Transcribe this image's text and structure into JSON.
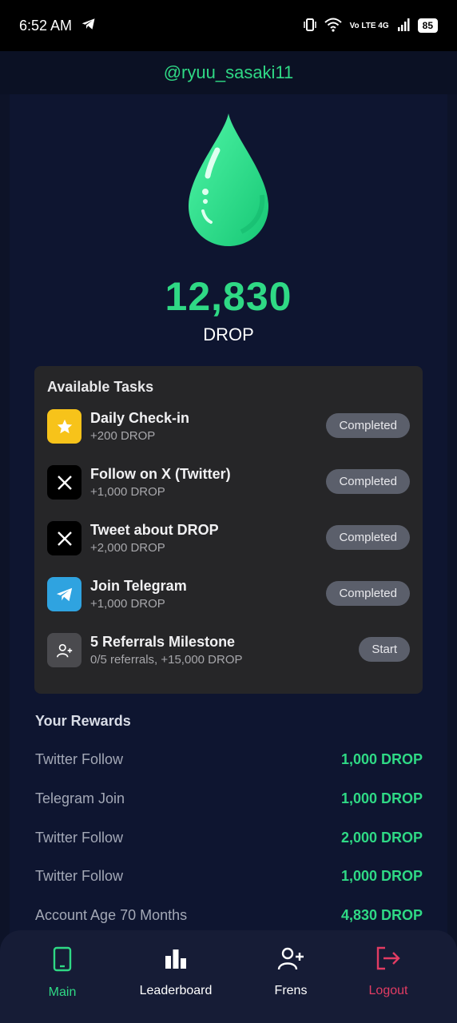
{
  "status_bar": {
    "time": "6:52 AM",
    "network": "Vo LTE 4G",
    "battery": "85"
  },
  "header": {
    "username": "@ryuu_sasaki11"
  },
  "balance": {
    "amount": "12,830",
    "unit": "DROP"
  },
  "tasks": {
    "title": "Available Tasks",
    "items": [
      {
        "name": "Daily Check-in",
        "reward": "+200 DROP",
        "action": "Completed",
        "icon": "star-icon",
        "color": "#f7c31a"
      },
      {
        "name": "Follow on X (Twitter)",
        "reward": "+1,000 DROP",
        "action": "Completed",
        "icon": "x-logo-icon",
        "color": "#000000"
      },
      {
        "name": "Tweet about DROP",
        "reward": "+2,000 DROP",
        "action": "Completed",
        "icon": "x-logo-icon",
        "color": "#000000"
      },
      {
        "name": "Join Telegram",
        "reward": "+1,000 DROP",
        "action": "Completed",
        "icon": "telegram-icon",
        "color": "#2fa3e0"
      },
      {
        "name": "5 Referrals Milestone",
        "reward": "0/5 referrals, +15,000 DROP",
        "action": "Start",
        "icon": "add-user-icon",
        "color": "#4a4a4e"
      }
    ]
  },
  "rewards": {
    "title": "Your Rewards",
    "items": [
      {
        "label": "Twitter Follow",
        "value": "1,000 DROP"
      },
      {
        "label": "Telegram Join",
        "value": "1,000 DROP"
      },
      {
        "label": "Twitter Follow",
        "value": "2,000 DROP"
      },
      {
        "label": "Twitter Follow",
        "value": "1,000 DROP"
      },
      {
        "label": "Account Age 70 Months",
        "value": "4,830 DROP"
      }
    ]
  },
  "nav": {
    "items": [
      {
        "label": "Main",
        "icon": "phone-icon",
        "color": "#2fd985"
      },
      {
        "label": "Leaderboard",
        "icon": "bar-chart-icon",
        "color": "#ffffff"
      },
      {
        "label": "Frens",
        "icon": "add-user-icon",
        "color": "#ffffff"
      },
      {
        "label": "Logout",
        "icon": "logout-icon",
        "color": "#e23c63"
      }
    ]
  },
  "colors": {
    "accent": "#2fd985",
    "background": "#0e1428",
    "card": "#262628",
    "danger": "#e23c63"
  }
}
